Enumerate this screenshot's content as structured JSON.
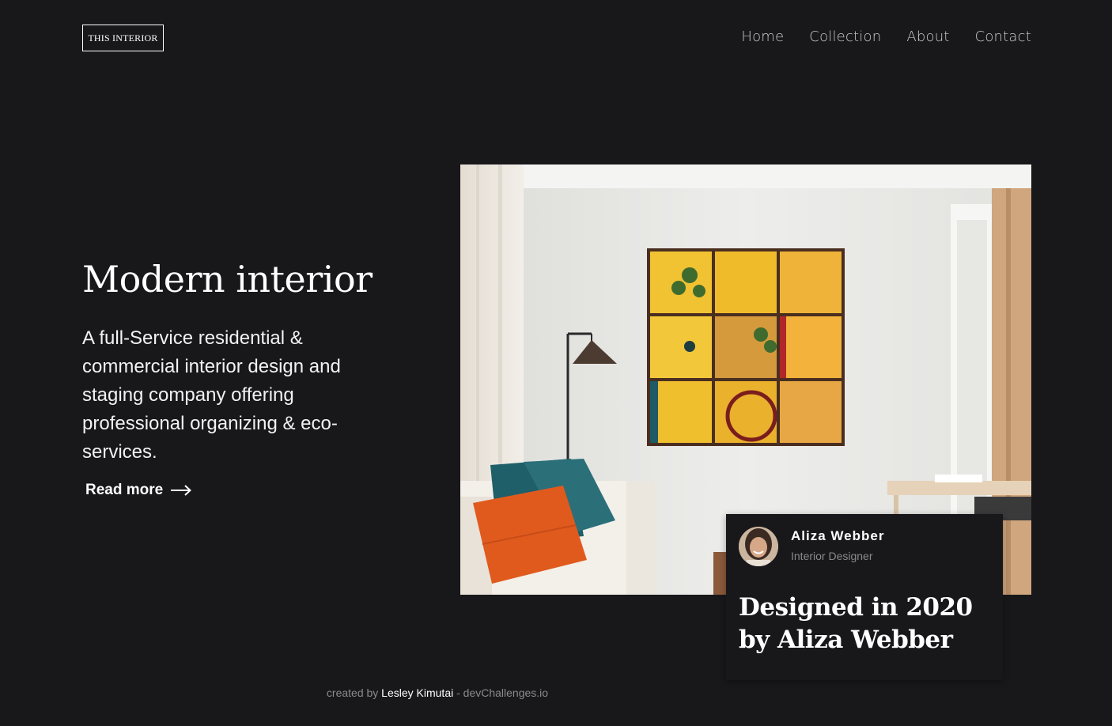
{
  "brand": {
    "logo_text": "THIS INTERIOR"
  },
  "nav": {
    "items": [
      "Home",
      "Collection",
      "About",
      "Contact"
    ]
  },
  "hero": {
    "title": "Modern interior",
    "description": "A full-Service residential & commercial interior design and staging company offering professional organizing & eco-services.",
    "cta_label": "Read more",
    "cta_icon": "arrow-right-icon"
  },
  "card": {
    "name": "Aliza Webber",
    "role": "Interior Designer",
    "title": "Designed in 2020 by Aliza Webber"
  },
  "footer": {
    "prefix": "created by",
    "author": "Lesley Kimutai",
    "suffix": "- devChallenges.io"
  },
  "colors": {
    "background": "#18181b",
    "text": "#ffffff",
    "muted": "#8a8a8e"
  }
}
